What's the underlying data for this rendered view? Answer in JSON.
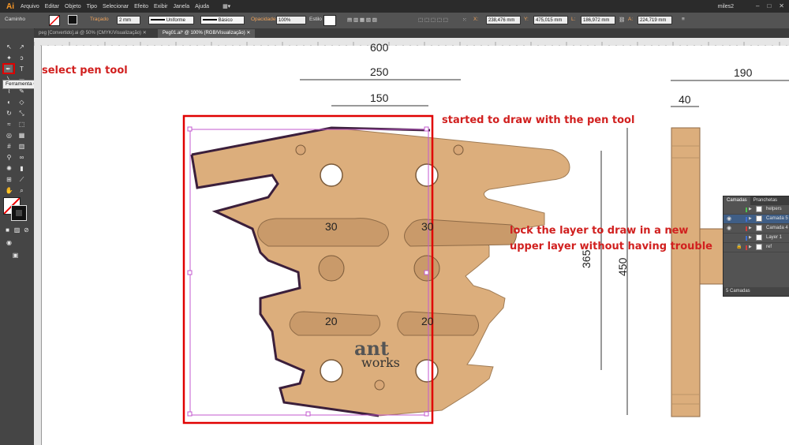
{
  "app": {
    "logo": "Ai",
    "menus": [
      "Arquivo",
      "Editar",
      "Objeto",
      "Tipo",
      "Selecionar",
      "Efeito",
      "Exibir",
      "Janela",
      "Ajuda"
    ],
    "user": "miles2"
  },
  "control_bar": {
    "selection_label": "Caminho",
    "stroke_label": "Traçado",
    "stroke_value": "2 mm",
    "profile": "Uniforme",
    "brush": "Básico",
    "opacity_label": "Opacidade",
    "opacity_value": "100%",
    "style_label": "Estilo",
    "x_value": "238,476 mm",
    "y_value": "475,015 mm",
    "w_value": "186,972 mm",
    "h_value": "224,719 mm"
  },
  "tabs": [
    {
      "label": "peg [Convertido].ai @ 50% (CMYK/Visualização)",
      "active": false
    },
    {
      "label": "Peg01.ai* @ 100% (RGB/Visualização)",
      "active": true
    }
  ],
  "tooltip": "Ferramenta Caneta (P)",
  "annotations": {
    "pen_tool": "select pen tool",
    "draw": "started to draw with the pen tool",
    "lock_line1": "lock the layer to draw in a new",
    "lock_line2": "upper layer without having trouble"
  },
  "drawing": {
    "dim_600": "600",
    "dim_250": "250",
    "dim_150": "150",
    "dim_190": "190",
    "dim_40": "40",
    "dim_365": "365",
    "dim_450": "450",
    "slot_30a": "30",
    "slot_30b": "30",
    "slot_20a": "20",
    "slot_20b": "20",
    "logo_line1": "ant",
    "logo_line2": "works"
  },
  "layers_panel": {
    "tabs": [
      "Camadas",
      "Pranchetas"
    ],
    "layers": [
      {
        "name": "helpers",
        "color": "#4ec34e",
        "visible": false,
        "locked": false,
        "selected": false
      },
      {
        "name": "Camada 5",
        "color": "#3f6fd1",
        "visible": true,
        "locked": false,
        "selected": true
      },
      {
        "name": "Camada 4",
        "color": "#d13f3f",
        "visible": true,
        "locked": false,
        "selected": false
      },
      {
        "name": "Layer 1",
        "color": "#3f6fd1",
        "visible": false,
        "locked": false,
        "selected": false
      },
      {
        "name": "ref",
        "color": "#d13f3f",
        "visible": false,
        "locked": true,
        "selected": false
      }
    ],
    "footer": "5 Camadas"
  },
  "colors": {
    "annotation_red": "#d1201f",
    "wood": "#dcae7c",
    "wood_dark": "#c79a69"
  }
}
